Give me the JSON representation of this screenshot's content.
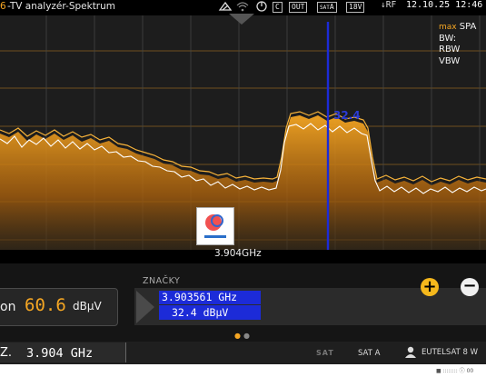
{
  "header": {
    "number": "6",
    "title": "-TV analyzér-Spektrum",
    "box_c": "C",
    "box_out": "OUT",
    "box_sat": "SAT",
    "box_sat_sub": "A",
    "box_voltage": "18V",
    "rf": "↓RF",
    "datetime": "12.10.25 12:46"
  },
  "spectrum": {
    "max_label": "max",
    "info_lines": [
      "SPA",
      "BW:",
      "RBW",
      "VBW"
    ],
    "marker_value": "32.4",
    "center_freq": "3.904GHz",
    "colors": {
      "fill": "#f5a623",
      "trace": "#ffffff",
      "marker": "#1c2bd8",
      "grid": "#d08a1f"
    }
  },
  "level": {
    "label": "on",
    "value": "60.6",
    "unit": "dBμV"
  },
  "markers": {
    "title": "ZNAČKY",
    "freq": "3.903561 GHz",
    "level": "32.4 dBμV"
  },
  "buttons": {
    "plus": "+",
    "minus": "−"
  },
  "bottom": {
    "freq_prefix": "Z.",
    "freq": "3.904 GHz",
    "sat_icon": "SAT",
    "sat": "SAT A",
    "satellite": "EUTELSAT 8 W"
  },
  "footer": {
    "text": "■ ::::::::   ⓘ 00"
  }
}
